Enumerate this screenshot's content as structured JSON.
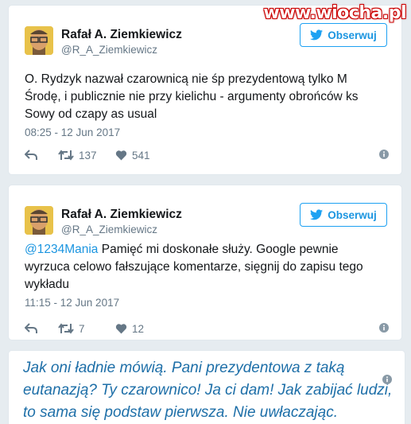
{
  "watermark": "www.wiocha.pl",
  "colors": {
    "accent": "#1da1f2",
    "caption_text": "#1e6fa8",
    "background": "#e6ecf0"
  },
  "tweets": [
    {
      "author_name": "Rafał A. Ziemkiewicz",
      "author_handle": "@R_A_Ziemkiewicz",
      "follow_label": "Obserwuj",
      "text": "O. Rydzyk nazwał czarownicą nie śp prezydentową tylko M Środę, i publicznie nie przy kielichu - argumenty obrońców ks Sowy od czapy as usual",
      "mention": "",
      "timestamp": "08:25 - 12 Jun 2017",
      "retweets": "137",
      "likes": "541"
    },
    {
      "author_name": "Rafał A. Ziemkiewicz",
      "author_handle": "@R_A_Ziemkiewicz",
      "follow_label": "Obserwuj",
      "mention": "@1234Mania",
      "text": "Pamięć mi doskonałe służy. Google pewnie wyrzuca celowo fałszujące komentarze, sięgnij do zapisu tego wykładu",
      "timestamp": "11:15 - 12 Jun 2017",
      "retweets": "7",
      "likes": "12"
    }
  ],
  "caption": {
    "text": "Jak oni ładnie mówią. Pani prezydentowa z taką eutanazją? Ty czarownico! Ja ci dam! Jak zabijać ludzi, to sama się podstaw pierwsza. Nie uwłaczając."
  }
}
